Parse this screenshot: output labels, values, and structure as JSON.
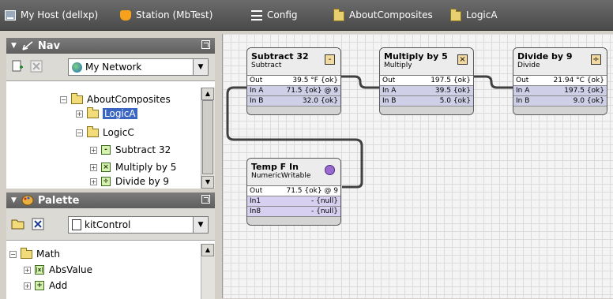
{
  "breadcrumbs": [
    {
      "label": "My Host (dellxp)",
      "icon": "host-icon"
    },
    {
      "label": "Station (MbTest)",
      "icon": "station-icon"
    },
    {
      "label": "Config",
      "icon": "config-icon"
    },
    {
      "label": "AboutComposites",
      "icon": "folder-icon"
    },
    {
      "label": "LogicA",
      "icon": "folder-icon"
    }
  ],
  "nav": {
    "title": "Nav",
    "network": "My Network",
    "tree": [
      {
        "label": "AboutComposites",
        "expander": "−"
      },
      {
        "label": "LogicA",
        "expander": "+",
        "selected": true
      },
      {
        "label": "LogicC",
        "expander": "−"
      },
      {
        "label": "Subtract 32",
        "expander": "+",
        "glyph": "-"
      },
      {
        "label": "Multiply by 5",
        "expander": "+",
        "glyph": "×"
      },
      {
        "label": "Divide by 9",
        "expander": "+",
        "glyph": "÷"
      }
    ]
  },
  "palette": {
    "title": "Palette",
    "module": "kitControl",
    "tree": [
      {
        "label": "Math",
        "expander": "−"
      },
      {
        "label": "AbsValue",
        "expander": "+",
        "glyph": "|x|"
      },
      {
        "label": "Add",
        "expander": "+",
        "glyph": "+"
      }
    ]
  },
  "components": {
    "subtract": {
      "title": "Subtract 32",
      "type": "Subtract",
      "badge": "-",
      "slots": [
        {
          "name": "Out",
          "value": "39.5 °F {ok}"
        },
        {
          "name": "In A",
          "value": "71.5 {ok} @ 9"
        },
        {
          "name": "In B",
          "value": "32.0 {ok}"
        }
      ]
    },
    "multiply": {
      "title": "Multiply by 5",
      "type": "Multiply",
      "badge": "×",
      "slots": [
        {
          "name": "Out",
          "value": "197.5 {ok}"
        },
        {
          "name": "In A",
          "value": "39.5 {ok}"
        },
        {
          "name": "In B",
          "value": "5.0 {ok}"
        }
      ]
    },
    "divide": {
      "title": "Divide by 9",
      "type": "Divide",
      "badge": "÷",
      "slots": [
        {
          "name": "Out",
          "value": "21.94 °C {ok}"
        },
        {
          "name": "In A",
          "value": "197.5 {ok}"
        },
        {
          "name": "In B",
          "value": "9.0 {ok}"
        }
      ]
    },
    "tempf": {
      "title": "Temp F In",
      "type": "NumericWritable",
      "slots": [
        {
          "name": "Out",
          "value": "71.5 {ok} @ 9"
        },
        {
          "name": "In1",
          "value": "- {null}"
        },
        {
          "name": "In8",
          "value": "- {null}"
        }
      ]
    }
  },
  "colors": {
    "selection": "#3a66c2",
    "status_badge": "#9a6ad0"
  }
}
